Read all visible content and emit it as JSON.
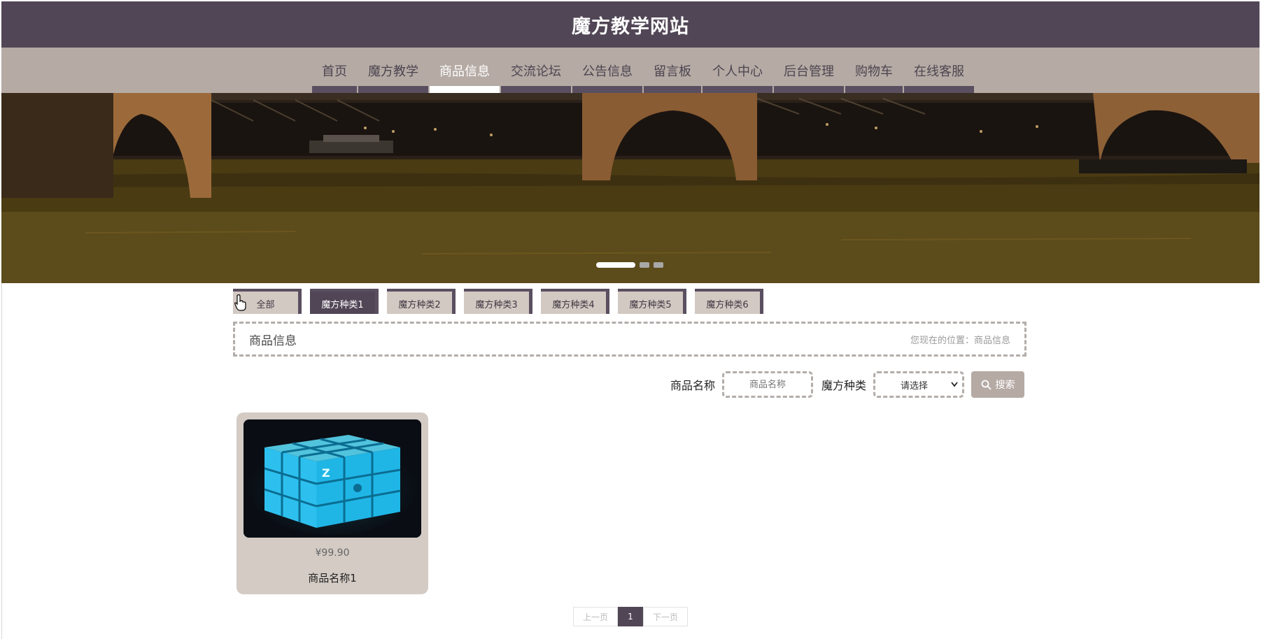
{
  "site": {
    "title": "魔方教学网站"
  },
  "nav": {
    "items": [
      {
        "label": "首页"
      },
      {
        "label": "魔方教学"
      },
      {
        "label": "商品信息",
        "active": true
      },
      {
        "label": "交流论坛"
      },
      {
        "label": "公告信息"
      },
      {
        "label": "留言板"
      },
      {
        "label": "个人中心"
      },
      {
        "label": "后台管理"
      },
      {
        "label": "购物车"
      },
      {
        "label": "在线客服"
      }
    ]
  },
  "banner": {
    "slide_count": 3,
    "active_slide": 1
  },
  "categories": {
    "items": [
      "全部",
      "魔方种类1",
      "魔方种类2",
      "魔方种类3",
      "魔方种类4",
      "魔方种类5",
      "魔方种类6"
    ],
    "active": "魔方种类1"
  },
  "breadcrumb": {
    "title": "商品信息",
    "location": "您现在的位置：商品信息"
  },
  "search": {
    "name_label": "商品名称",
    "name_placeholder": "商品名称",
    "type_label": "魔方种类",
    "type_selected": "请选择",
    "button_label": "搜索"
  },
  "products": [
    {
      "price": "¥99.90",
      "name": "商品名称1",
      "image": "glowing-cube-image"
    }
  ],
  "pagination": {
    "prev": "上一页",
    "current": "1",
    "next": "下一页"
  },
  "colors": {
    "header": "#514656",
    "nav": "#b5aaa4",
    "card": "#d3cbc4",
    "accent": "#5a4f60"
  }
}
